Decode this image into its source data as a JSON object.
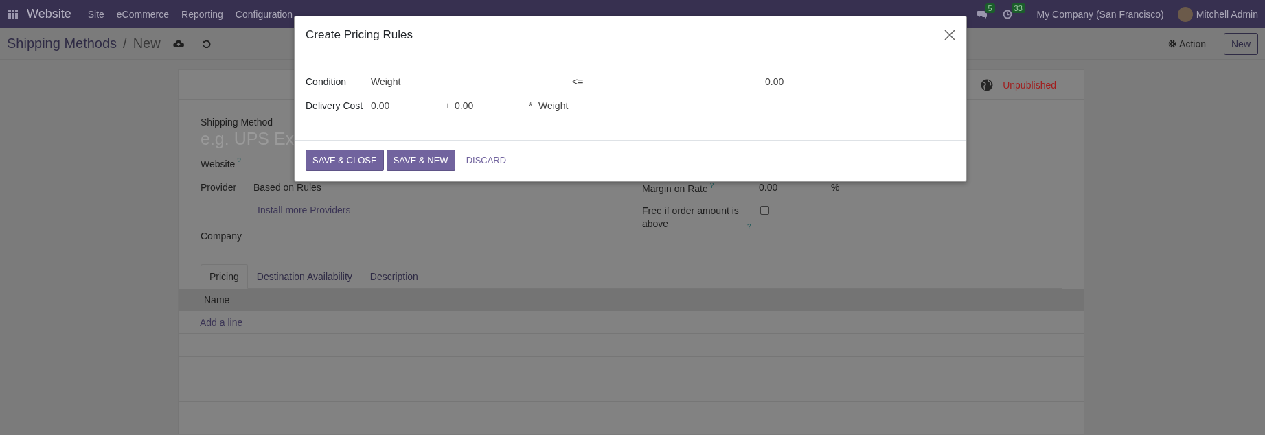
{
  "navbar": {
    "app_title": "Website",
    "menu": [
      "Site",
      "eCommerce",
      "Reporting",
      "Configuration"
    ],
    "messages_badge": "5",
    "activities_badge": "33",
    "company": "My Company (San Francisco)",
    "user": "Mitchell Admin"
  },
  "control_panel": {
    "breadcrumb": [
      "Shipping Methods",
      "New"
    ],
    "separator": "/",
    "action": "Action",
    "new_button": "New"
  },
  "form": {
    "status": "Unpublished",
    "shipping_method": {
      "label": "Shipping Method",
      "placeholder": "e.g. UPS Ex"
    },
    "website": {
      "label": "Website",
      "help": "?"
    },
    "provider": {
      "label": "Provider",
      "value": "Based on Rules",
      "link": "Install more Providers"
    },
    "company": {
      "label": "Company"
    },
    "margin_on_rate": {
      "label": "Margin on Rate",
      "help": "?",
      "value": "0.00",
      "unit": "%"
    },
    "free_if_above": {
      "label": "Free if order amount is above",
      "help": "?",
      "checked": false
    },
    "tabs": [
      {
        "label": "Pricing",
        "selected": true
      },
      {
        "label": "Destination Availability",
        "selected": false
      },
      {
        "label": "Description",
        "selected": false
      }
    ],
    "table": {
      "columns": [
        "Name"
      ],
      "add_line": "Add a line"
    }
  },
  "dialog": {
    "title": "Create Pricing Rules",
    "condition": {
      "label": "Condition",
      "variable": "Weight",
      "operator": "<=",
      "value": "0.00"
    },
    "delivery_cost": {
      "label": "Delivery Cost",
      "fixed": "0.00",
      "plus": "+",
      "factor": "0.00",
      "times": "*",
      "variable": "Weight"
    },
    "buttons": [
      {
        "label": "SAVE & CLOSE",
        "kind": "primary"
      },
      {
        "label": "SAVE & NEW",
        "kind": "primary"
      },
      {
        "label": "DISCARD",
        "kind": "link"
      }
    ]
  }
}
